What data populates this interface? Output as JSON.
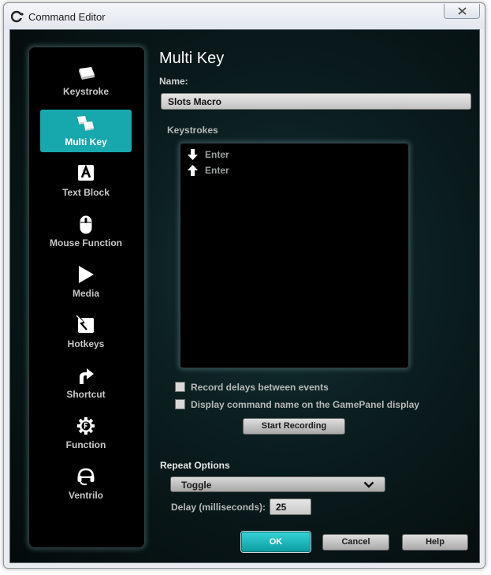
{
  "window": {
    "title": "Command Editor"
  },
  "sidebar": {
    "items": [
      {
        "label": "Keystroke",
        "icon": "keystroke-icon"
      },
      {
        "label": "Multi Key",
        "icon": "multi-key-icon"
      },
      {
        "label": "Text Block",
        "icon": "text-block-icon"
      },
      {
        "label": "Mouse Function",
        "icon": "mouse-icon"
      },
      {
        "label": "Media",
        "icon": "play-icon"
      },
      {
        "label": "Hotkeys",
        "icon": "hotkeys-icon"
      },
      {
        "label": "Shortcut",
        "icon": "shortcut-arrow-icon"
      },
      {
        "label": "Function",
        "icon": "function-gear-icon"
      },
      {
        "label": "Ventrilo",
        "icon": "headset-icon"
      }
    ],
    "active": "Multi Key"
  },
  "main": {
    "title": "Multi Key",
    "name_label": "Name:",
    "name_value": "Slots Macro",
    "keystrokes_label": "Keystrokes",
    "keystrokes": [
      {
        "direction": "down",
        "key": "Enter"
      },
      {
        "direction": "up",
        "key": "Enter"
      }
    ],
    "record_delays_label": "Record delays between events",
    "display_name_label": "Display command name on the GamePanel display",
    "start_recording_label": "Start Recording",
    "repeat_options_label": "Repeat Options",
    "repeat_value": "Toggle",
    "delay_label": "Delay (milliseconds):",
    "delay_value": "25"
  },
  "buttons": {
    "ok": "OK",
    "cancel": "Cancel",
    "help": "Help"
  },
  "colors": {
    "accent": "#16a8ad",
    "ok_button": "#19adb1",
    "background": "#0b1e20"
  }
}
